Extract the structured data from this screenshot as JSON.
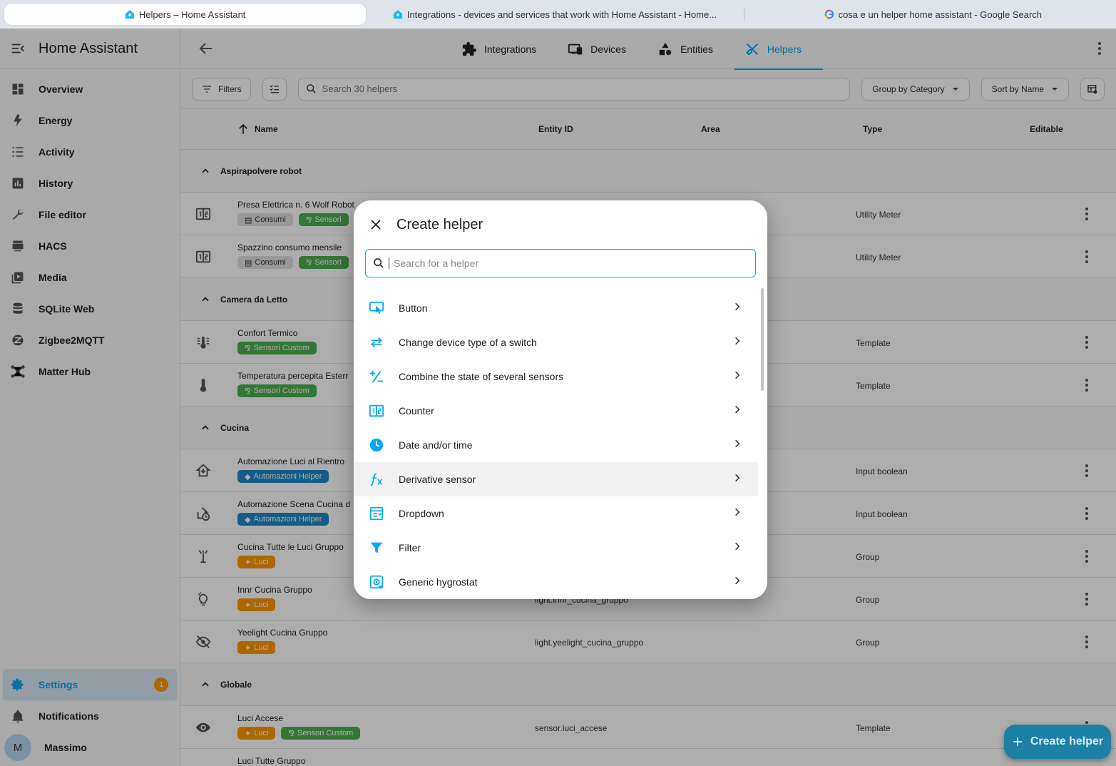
{
  "browser": {
    "tabs": [
      {
        "title": "Helpers – Home Assistant",
        "active": true
      },
      {
        "title": "Integrations - devices and services that work with Home Assistant - Home...",
        "active": false
      },
      {
        "title": "cosa e un helper home assistant - Google Search",
        "active": false
      }
    ]
  },
  "sidebar": {
    "title": "Home Assistant",
    "items": [
      {
        "label": "Overview",
        "icon": "dashboard-icon"
      },
      {
        "label": "Energy",
        "icon": "lightning-bolt-icon"
      },
      {
        "label": "Activity",
        "icon": "list-icon"
      },
      {
        "label": "History",
        "icon": "chart-bar-icon"
      },
      {
        "label": "File editor",
        "icon": "wrench-icon"
      },
      {
        "label": "HACS",
        "icon": "hacs-icon"
      },
      {
        "label": "Media",
        "icon": "play-box-icon"
      },
      {
        "label": "SQLite Web",
        "icon": "database-icon"
      },
      {
        "label": "Zigbee2MQTT",
        "icon": "zigbee-icon"
      },
      {
        "label": "Matter Hub",
        "icon": "hub-icon"
      }
    ],
    "settings": {
      "label": "Settings",
      "badge": "1"
    },
    "notifications": {
      "label": "Notifications"
    },
    "user": {
      "initial": "M",
      "name": "Massimo"
    }
  },
  "topnav": {
    "tabs": [
      {
        "label": "Integrations",
        "icon": "puzzle-icon"
      },
      {
        "label": "Devices",
        "icon": "devices-icon"
      },
      {
        "label": "Entities",
        "icon": "shapes-icon"
      },
      {
        "label": "Helpers",
        "icon": "tools-icon",
        "active": true
      }
    ]
  },
  "toolbar": {
    "filters_label": "Filters",
    "search_placeholder": "Search 30 helpers",
    "group_by_label": "Group by Category",
    "sort_by_label": "Sort by Name"
  },
  "table": {
    "columns": {
      "name": "Name",
      "entity_id": "Entity ID",
      "area": "Area",
      "type": "Type",
      "editable": "Editable"
    },
    "groups": [
      {
        "name": "Aspirapolvere robot",
        "rows": [
          {
            "name": "Presa Elettrica n. 6 Wolf Robot",
            "chips": [
              {
                "label": "Consumi",
                "color": "grey"
              },
              {
                "label": "Sensori",
                "color": "green"
              }
            ],
            "entity_id": "",
            "type": "Utility Meter",
            "icon": "counter-icon"
          },
          {
            "name": "Spazzino consumo mensile",
            "chips": [
              {
                "label": "Consumi",
                "color": "grey"
              },
              {
                "label": "Sensori",
                "color": "green"
              }
            ],
            "entity_id": "",
            "type": "Utility Meter",
            "icon": "counter-icon"
          }
        ]
      },
      {
        "name": "Camera da Letto",
        "rows": [
          {
            "name": "Confort Termico",
            "chips": [
              {
                "label": "Sensori Custom",
                "color": "green"
              }
            ],
            "entity_id": "",
            "type": "Template",
            "icon": "thermometer-lines-icon"
          },
          {
            "name": "Temperatura percepita Esterr",
            "chips": [
              {
                "label": "Sensori Custom",
                "color": "green"
              }
            ],
            "entity_id": "",
            "type": "Template",
            "icon": "thermometer-icon"
          }
        ]
      },
      {
        "name": "Cucina",
        "rows": [
          {
            "name": "Automazione Luci al Rientro",
            "chips": [
              {
                "label": "Automazioni Helper",
                "color": "blue"
              }
            ],
            "entity_id": "",
            "type": "Input boolean",
            "icon": "home-import-icon"
          },
          {
            "name": "Automazione Scena Cucina d",
            "chips": [
              {
                "label": "Automazioni Helper",
                "color": "blue"
              }
            ],
            "entity_id": "",
            "type": "Input boolean",
            "icon": "home-clock-icon"
          },
          {
            "name": "Cucina Tutte le Luci Gruppo",
            "chips": [
              {
                "label": "Luci",
                "color": "orange"
              }
            ],
            "entity_id": "",
            "type": "Group",
            "icon": "floor-lamp-icon"
          },
          {
            "name": "Innr Cucina Gruppo",
            "chips": [
              {
                "label": "Luci",
                "color": "orange"
              }
            ],
            "entity_id": "light.innr_cucina_gruppo",
            "type": "Group",
            "icon": "lightbulb-group-icon"
          },
          {
            "name": "Yeelight Cucina Gruppo",
            "chips": [
              {
                "label": "Luci",
                "color": "orange"
              }
            ],
            "entity_id": "light.yeelight_cucina_gruppo",
            "type": "Group",
            "icon": "eye-off-icon"
          }
        ]
      },
      {
        "name": "Globale",
        "rows": [
          {
            "name": "Luci Accese",
            "chips": [
              {
                "label": "Luci",
                "color": "orange"
              },
              {
                "label": "Sensori Custom",
                "color": "green"
              }
            ],
            "entity_id": "sensor.luci_accese",
            "type": "Template",
            "icon": "eye-icon"
          },
          {
            "name": "Luci Tutte Gruppo",
            "chips": [],
            "entity_id": "",
            "type": "",
            "icon": ""
          }
        ]
      }
    ]
  },
  "dialog": {
    "title": "Create helper",
    "search_placeholder": "Search for a helper",
    "items": [
      {
        "label": "Button",
        "icon": "gesture-tap-button-icon"
      },
      {
        "label": "Change device type of a switch",
        "icon": "swap-horizontal-icon"
      },
      {
        "label": "Combine the state of several sensors",
        "icon": "plus-minus-icon"
      },
      {
        "label": "Counter",
        "icon": "counter-icon"
      },
      {
        "label": "Date and/or time",
        "icon": "clock-icon"
      },
      {
        "label": "Derivative sensor",
        "icon": "function-variant-icon"
      },
      {
        "label": "Dropdown",
        "icon": "form-dropdown-icon"
      },
      {
        "label": "Filter",
        "icon": "filter-icon"
      },
      {
        "label": "Generic hygrostat",
        "icon": "hygrostat-icon"
      }
    ]
  },
  "fab": {
    "label": "Create helper"
  },
  "colors": {
    "accent": "#03a9f4",
    "badge": "#ff9800",
    "chip_green": "#4caf50",
    "chip_blue": "#1e88c8",
    "chip_orange": "#ff9800"
  }
}
